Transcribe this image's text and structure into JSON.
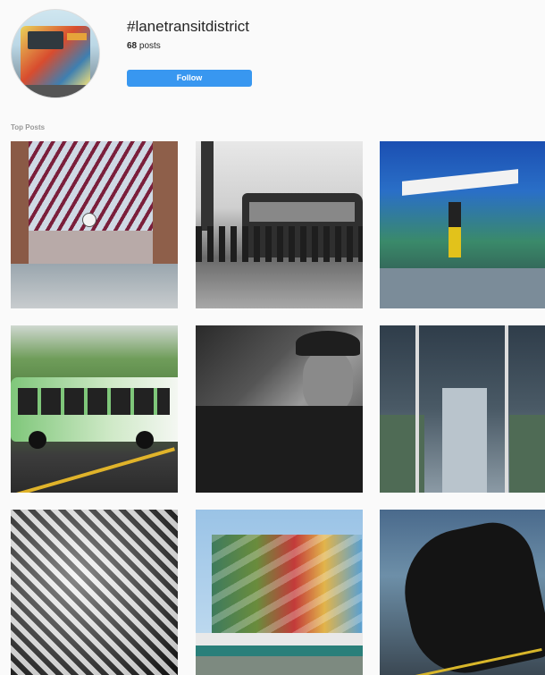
{
  "header": {
    "hashtag": "#lanetransitdistrict",
    "post_count": "68",
    "posts_suffix": " posts",
    "follow_label": "Follow"
  },
  "section": {
    "label": "Top Posts"
  },
  "colors": {
    "accent": "#3897f0",
    "text": "#262626",
    "muted": "#999999",
    "background": "#fafafa"
  },
  "posts": [
    {
      "name": "post-1"
    },
    {
      "name": "post-2"
    },
    {
      "name": "post-3"
    },
    {
      "name": "post-4"
    },
    {
      "name": "post-5"
    },
    {
      "name": "post-6"
    },
    {
      "name": "post-7"
    },
    {
      "name": "post-8"
    },
    {
      "name": "post-9"
    }
  ]
}
